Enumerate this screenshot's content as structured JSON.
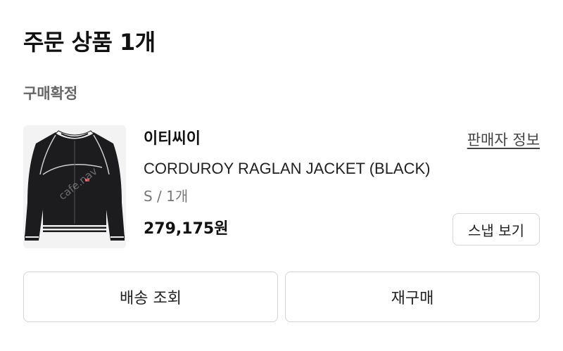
{
  "header": {
    "title": "주문 상품 1개"
  },
  "order": {
    "status": "구매확정",
    "item": {
      "brand": "이티씨이",
      "seller_info_label": "판매자 정보",
      "name": "CORDUROY RAGLAN JACKET (BLACK)",
      "option": "S / 1개",
      "price": "279,175원",
      "snap_button_label": "스냅 보기",
      "image_watermark": "cafe.nav"
    }
  },
  "actions": {
    "delivery_label": "배송 조회",
    "reorder_label": "재구매"
  },
  "colors": {
    "text_primary": "#111111",
    "text_secondary": "#777777",
    "border": "#d6d6d6",
    "jacket": "#1c1c1e"
  }
}
